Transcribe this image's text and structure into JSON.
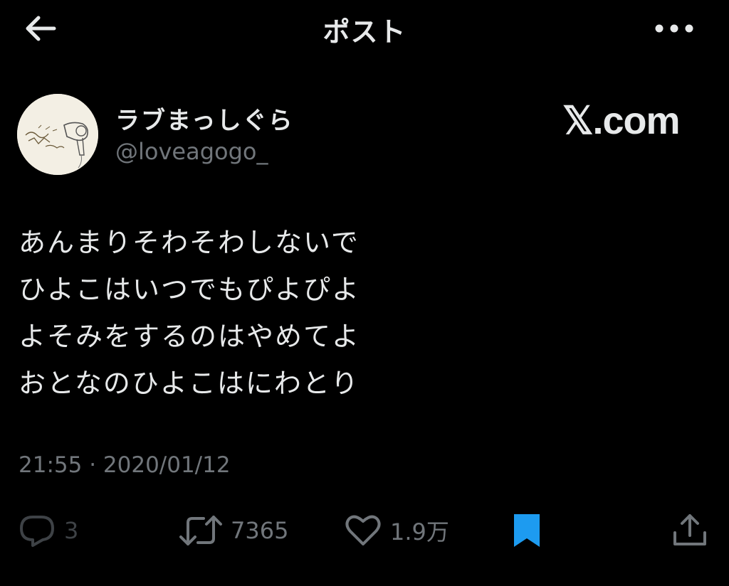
{
  "header": {
    "title": "ポスト",
    "back_icon": "arrow-left-icon",
    "more_icon": "more-horizontal-icon"
  },
  "author": {
    "display_name": "ラブまっしぐら",
    "handle": "@loveagogo_",
    "avatar_icon": "avatar-hairdryer-drawing"
  },
  "watermark": "𝕏.com",
  "post": {
    "lines": [
      "あんまりそわそわしないで",
      "ひよこはいつでもぴよぴよ",
      "よそみをするのはやめてよ",
      "おとなのひよこはにわとり"
    ],
    "timestamp": "21:55 · 2020/01/12"
  },
  "actions": {
    "reply": {
      "icon": "reply-icon",
      "count": "3"
    },
    "repost": {
      "icon": "repost-icon",
      "count": "7365"
    },
    "like": {
      "icon": "heart-icon",
      "count": "1.9万"
    },
    "bookmark": {
      "icon": "bookmark-icon",
      "active": true
    },
    "share": {
      "icon": "share-icon"
    }
  },
  "colors": {
    "background": "#000000",
    "text_primary": "#e7e9ea",
    "text_secondary": "#71767b",
    "bookmark_active": "#1d9bf0"
  }
}
